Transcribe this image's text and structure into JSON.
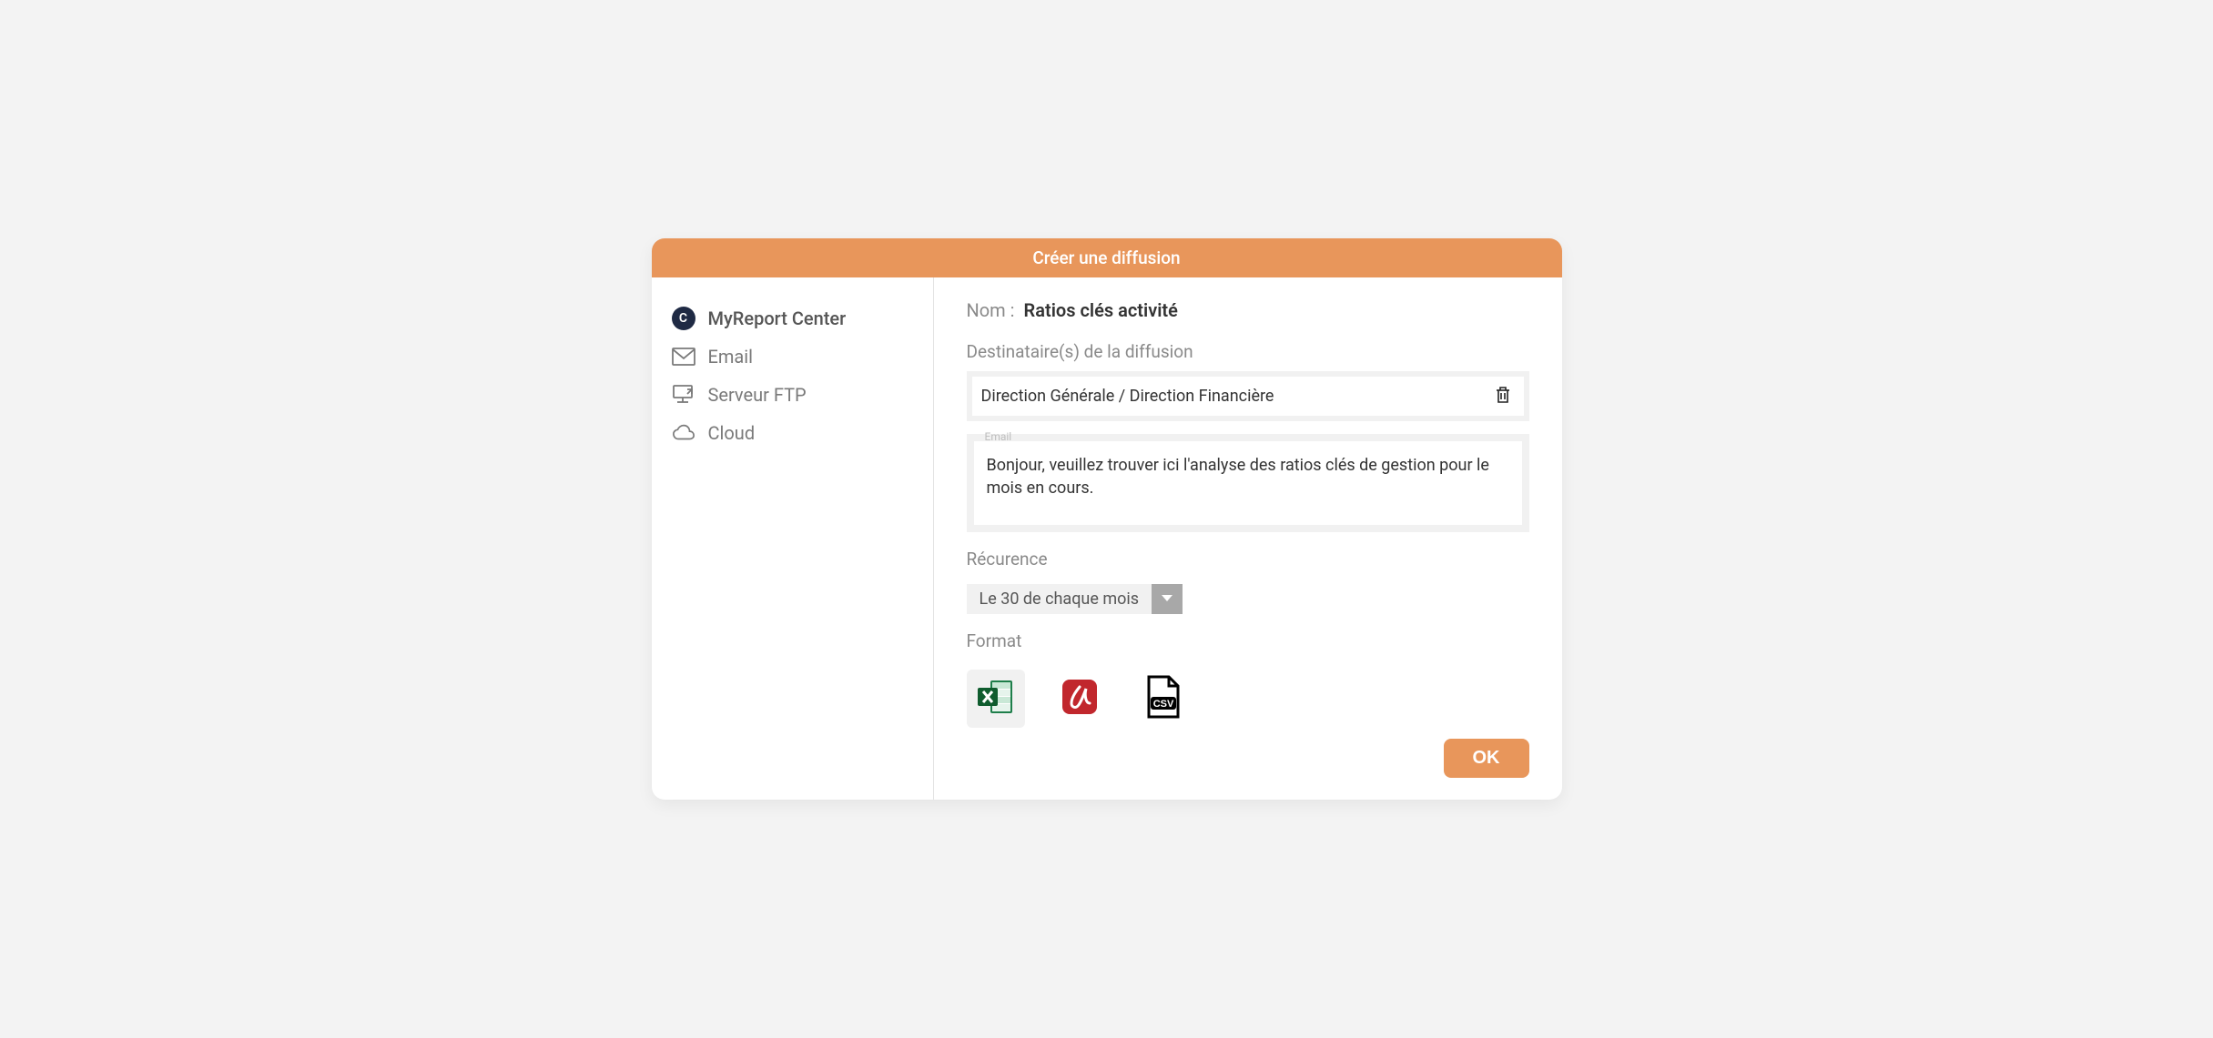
{
  "modal": {
    "title": "Créer une diffusion"
  },
  "sidebar": {
    "items": [
      {
        "label": "MyReport Center",
        "icon": "c-badge-icon",
        "selected": true
      },
      {
        "label": "Email",
        "icon": "mail-icon",
        "selected": false
      },
      {
        "label": "Serveur FTP",
        "icon": "ftp-icon",
        "selected": false
      },
      {
        "label": "Cloud",
        "icon": "cloud-icon",
        "selected": false
      }
    ]
  },
  "form": {
    "name_label": "Nom :",
    "name_value": "Ratios clés activité",
    "recipients_label": "Destinataire(s) de la diffusion",
    "recipient_value": "Direction Générale / Direction Financière",
    "email_legend": "Email",
    "email_body": "Bonjour, veuillez trouver ici l'analyse des ratios clés de gestion pour le mois en cours.",
    "recurrence_label": "Récurence",
    "recurrence_value": "Le 30 de chaque mois",
    "format_label": "Format",
    "formats": [
      {
        "name": "excel",
        "selected": true
      },
      {
        "name": "pdf",
        "selected": false
      },
      {
        "name": "csv",
        "selected": false
      }
    ],
    "ok_label": "OK"
  }
}
